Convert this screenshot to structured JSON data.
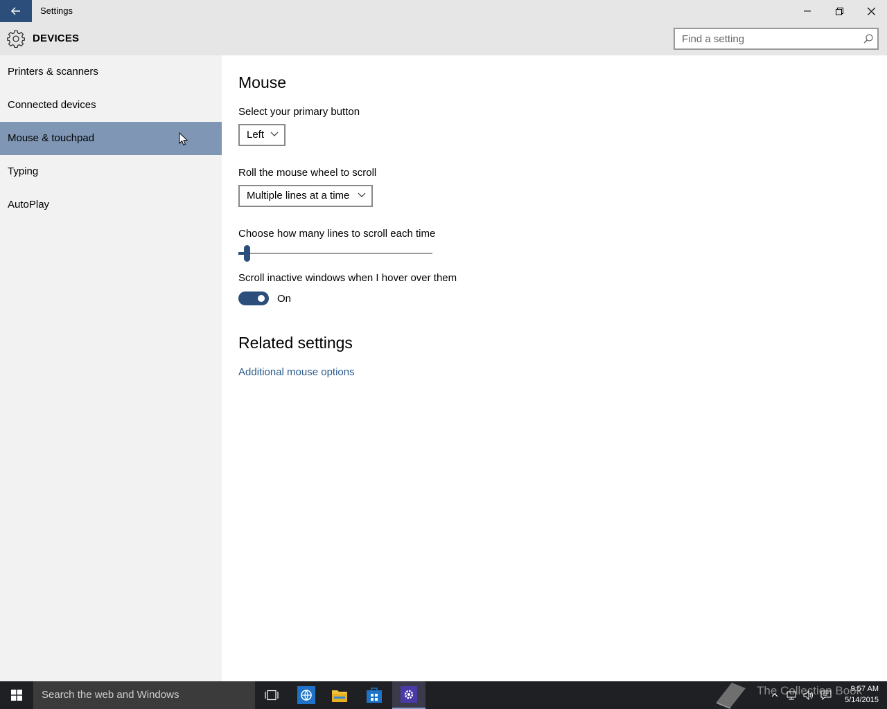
{
  "window": {
    "title": "Settings",
    "back_icon": "back-arrow-icon",
    "minimize_icon": "minimize-icon",
    "maximize_icon": "restore-icon",
    "close_icon": "close-icon"
  },
  "header": {
    "icon": "gear-icon",
    "title": "DEVICES",
    "search_placeholder": "Find a setting"
  },
  "sidebar": {
    "items": [
      {
        "label": "Printers & scanners",
        "selected": false
      },
      {
        "label": "Connected devices",
        "selected": false
      },
      {
        "label": "Mouse & touchpad",
        "selected": true
      },
      {
        "label": "Typing",
        "selected": false
      },
      {
        "label": "AutoPlay",
        "selected": false
      }
    ]
  },
  "main": {
    "title": "Mouse",
    "primary_button": {
      "label": "Select your primary button",
      "value": "Left"
    },
    "scroll_wheel": {
      "label": "Roll the mouse wheel to scroll",
      "value": "Multiple lines at a time"
    },
    "lines_slider": {
      "label": "Choose how many lines to scroll each time",
      "fraction": 0.03
    },
    "inactive_scroll": {
      "label": "Scroll inactive windows when I hover over them",
      "state": "On"
    },
    "related_title": "Related settings",
    "related_link": "Additional mouse options"
  },
  "taskbar": {
    "search_text": "Search the web and Windows",
    "icons": [
      "windows-start-icon",
      "task-view-icon",
      "internet-explorer-icon",
      "file-explorer-icon",
      "store-icon",
      "settings-gear-icon"
    ],
    "watermark": "The Collection Book",
    "time": "9:57 AM",
    "date": "5/14/2015"
  },
  "colors": {
    "accent": "#2b4e7a",
    "selected_nav": "#7f97b4",
    "chrome": "#e6e6e6",
    "sidebar": "#f2f2f2",
    "link": "#2b5a8c",
    "taskbar": "#1f2024"
  }
}
